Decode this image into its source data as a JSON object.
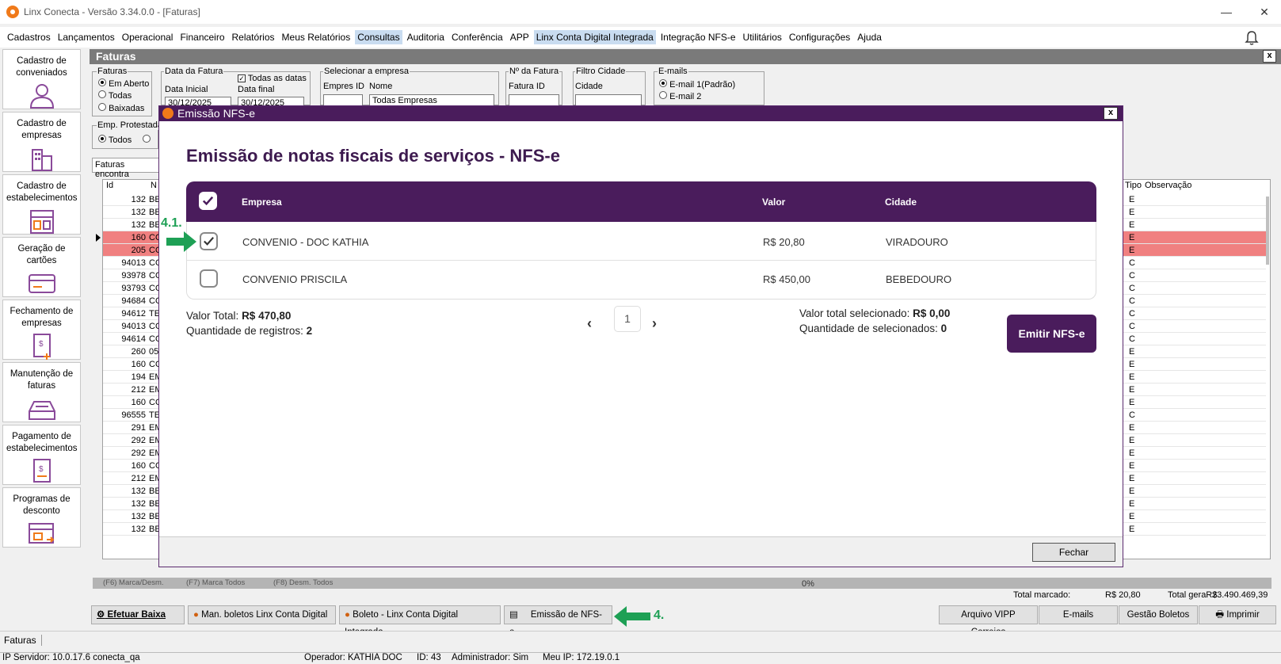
{
  "window": {
    "title": "Linx Conecta - Versão 3.34.0.0 - [Faturas]",
    "minimize": "—",
    "maximize": "☐",
    "close": "✕"
  },
  "menu": [
    "Cadastros",
    "Lançamentos",
    "Operacional",
    "Financeiro",
    "Relatórios",
    "Meus Relatórios",
    "Consultas",
    "Auditoria",
    "Conferência",
    "APP",
    "Linx Conta Digital Integrada",
    "Integração NFS-e",
    "Utilitários",
    "Configurações",
    "Ajuda"
  ],
  "sidebar": [
    {
      "label": "Cadastro de conveniados",
      "icon": "person-icon"
    },
    {
      "label": "Cadastro de empresas",
      "icon": "building-icon"
    },
    {
      "label": "Cadastro de estabelecimentos",
      "icon": "store-icon"
    },
    {
      "label": "Geração de cartões",
      "icon": "card-icon"
    },
    {
      "label": "Fechamento de empresas",
      "icon": "invoice-icon"
    },
    {
      "label": "Manutenção de faturas",
      "icon": "tray-icon"
    },
    {
      "label": "Pagamento de estabelecimentos",
      "icon": "payment-icon"
    },
    {
      "label": "Programas de desconto",
      "icon": "discount-icon"
    }
  ],
  "faturas": {
    "title": "Faturas",
    "close": "x",
    "filters": {
      "faturas_label": "Faturas",
      "radios": [
        "Em Aberto",
        "Todas",
        "Baixadas"
      ],
      "data_label": "Data da Fatura",
      "todas_datas": "Todas as datas",
      "data_inicial_label": "Data Inicial",
      "data_inicial": "30/12/2025",
      "data_final_label": "Data final",
      "data_final": "30/12/2025",
      "empresa_label": "Selecionar a empresa",
      "empresas_id_label": "Empres ID",
      "nome_label": "Nome",
      "nome_value": "Todas Empresas",
      "nfatura_label": "Nº da Fatura",
      "fatura_id_label": "Fatura ID",
      "filtro_cidade_label": "Filtro Cidade",
      "cidade_label": "Cidade",
      "emails_label": "E-mails",
      "email1": "E-mail 1(Padrão)",
      "email2": "E-mail 2",
      "emp_protestada_label": "Emp. Protestada",
      "emp_todos": "Todos",
      "faturas_encontradas": "Faturas encontra"
    },
    "grid": {
      "col_id": "Id",
      "col_n": "N",
      "col_tipo": "Tipo",
      "col_obs": "Observação",
      "rows": [
        {
          "id": "132",
          "n": "BE",
          "tipo": "E"
        },
        {
          "id": "132",
          "n": "BE",
          "tipo": "E"
        },
        {
          "id": "132",
          "n": "BE",
          "tipo": "E"
        },
        {
          "id": "160",
          "n": "CO",
          "tipo": "E"
        },
        {
          "id": "205",
          "n": "CO",
          "tipo": "E"
        },
        {
          "id": "94013",
          "n": "CO",
          "tipo": "C"
        },
        {
          "id": "93978",
          "n": "CO",
          "tipo": "C"
        },
        {
          "id": "93793",
          "n": "CO",
          "tipo": "C"
        },
        {
          "id": "94684",
          "n": "CO",
          "tipo": "C"
        },
        {
          "id": "94612",
          "n": "TE",
          "tipo": "C"
        },
        {
          "id": "94013",
          "n": "CO",
          "tipo": "C"
        },
        {
          "id": "94614",
          "n": "CO",
          "tipo": "C"
        },
        {
          "id": "260",
          "n": "05",
          "tipo": "E"
        },
        {
          "id": "160",
          "n": "CO",
          "tipo": "E"
        },
        {
          "id": "194",
          "n": "EM",
          "tipo": "E"
        },
        {
          "id": "212",
          "n": "EM",
          "tipo": "E"
        },
        {
          "id": "160",
          "n": "CO",
          "tipo": "E"
        },
        {
          "id": "96555",
          "n": "TE",
          "tipo": "C"
        },
        {
          "id": "291",
          "n": "EM",
          "tipo": "E"
        },
        {
          "id": "292",
          "n": "EM",
          "tipo": "E"
        },
        {
          "id": "292",
          "n": "EM",
          "tipo": "E"
        },
        {
          "id": "160",
          "n": "CO",
          "tipo": "E"
        },
        {
          "id": "212",
          "n": "EM",
          "tipo": "E"
        },
        {
          "id": "132",
          "n": "BE",
          "tipo": "E"
        },
        {
          "id": "132",
          "n": "BE",
          "tipo": "E"
        },
        {
          "id": "132",
          "n": "BE",
          "tipo": "E"
        },
        {
          "id": "132",
          "n": "BE",
          "tipo": "E"
        }
      ]
    },
    "hints": [
      "(F6) Marca/Desm.",
      "(F7) Marca Todos",
      "(F8) Desm. Todos"
    ],
    "progress": "0%",
    "total_marcado_label": "Total marcado:",
    "total_marcado": "R$  20,80",
    "total_geral_label": "Total geraR$",
    "total_geral": "23.490.469,39"
  },
  "toolbar": {
    "efetuar_baixa": "Efetuar Baixa",
    "man_boletos": "Man. boletos Linx Conta Digital",
    "boleto": "Boleto - Linx Conta Digital Integrada",
    "emissao": "Emissão de NFS-e",
    "arquivo_vipp": "Arquivo VIPP Correios",
    "emails": "E-mails",
    "gestao": "Gestão Boletos",
    "imprimir": "Imprimir"
  },
  "annotations": {
    "step4": "4.",
    "step41": "4.1."
  },
  "modal": {
    "title": "Emissão NFS-e",
    "close": "x",
    "heading": "Emissão de notas fiscais de serviços - NFS-e",
    "headers": {
      "empresa": "Empresa",
      "valor": "Valor",
      "cidade": "Cidade"
    },
    "rows": [
      {
        "empresa": "CONVENIO - DOC KATHIA",
        "valor": "R$ 20,80",
        "cidade": "VIRADOURO",
        "checked": true
      },
      {
        "empresa": "CONVENIO PRISCILA",
        "valor": "R$ 450,00",
        "cidade": "BEBEDOURO",
        "checked": false
      }
    ],
    "valor_total_label": "Valor Total:",
    "valor_total": "R$ 470,80",
    "qtd_registros_label": "Quantidade de registros:",
    "qtd_registros": "2",
    "page": "1",
    "valor_sel_label": "Valor total selecionado:",
    "valor_sel": "R$ 0,00",
    "qtd_sel_label": "Quantidade de selecionados:",
    "qtd_sel": "0",
    "emit_button": "Emitir NFS-e",
    "fechar": "Fechar"
  },
  "tabs": {
    "faturas": "Faturas"
  },
  "status": {
    "servidor": "IP Servidor: 10.0.17.6 conecta_qa",
    "operador": "Operador: KATHIA DOC",
    "id": "ID: 43",
    "admin": "Administrador: Sim",
    "meu_ip": "Meu IP: 172.19.0.1"
  },
  "colors": {
    "accent": "#4a1c5c",
    "highlight_row": "#f08080",
    "annotation": "#1ea055"
  }
}
